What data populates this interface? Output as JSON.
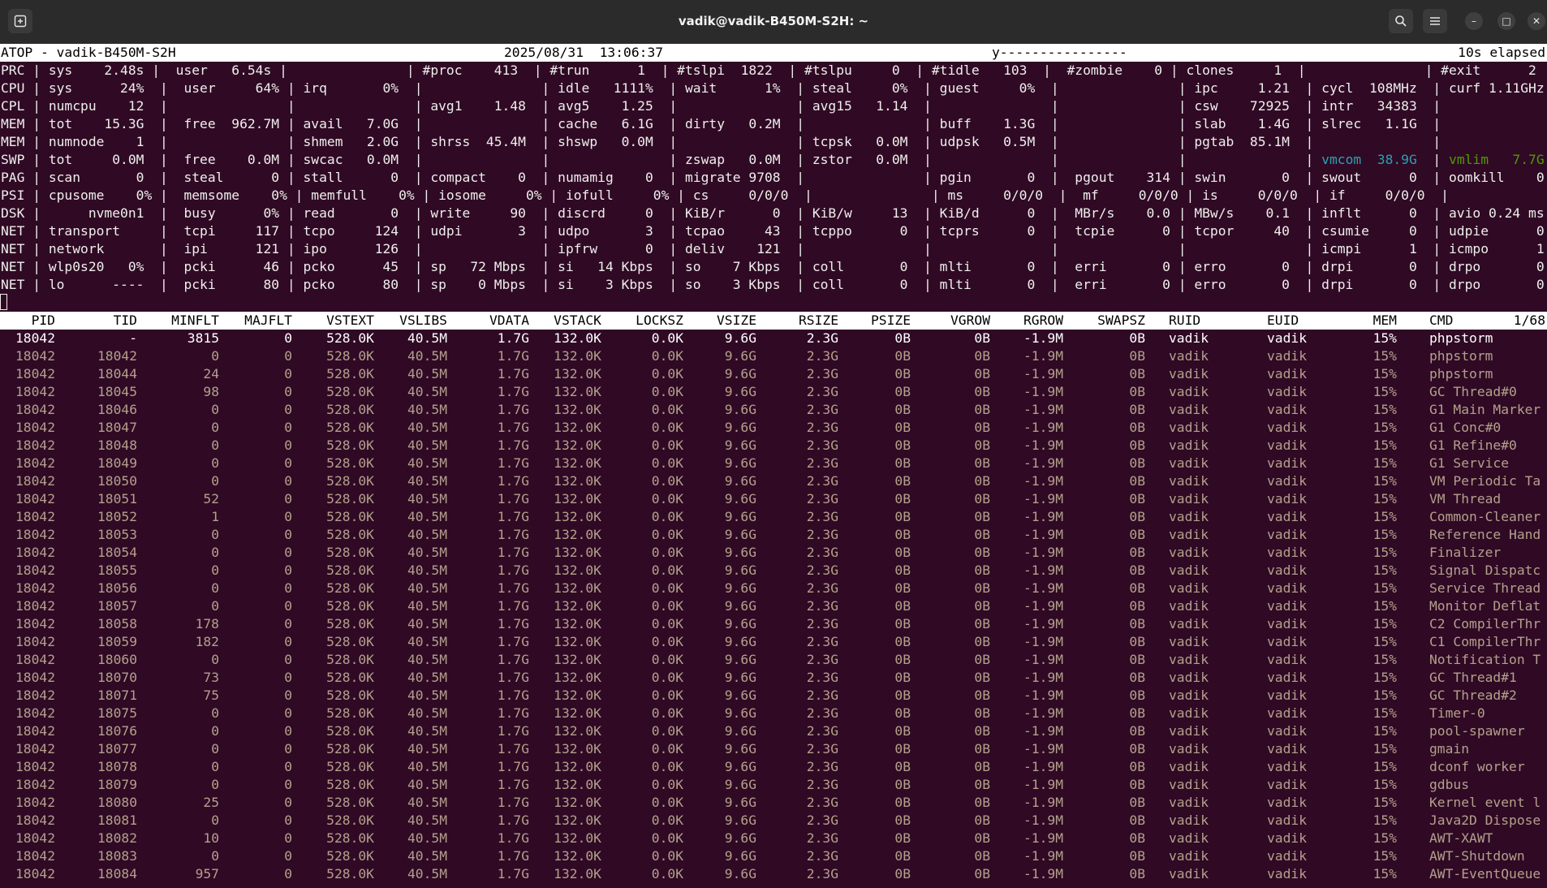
{
  "window": {
    "title": "vadik@vadik-B450M-S2H: ~"
  },
  "header": {
    "left": "ATOP - vadik-B450M-S2H",
    "datetime": "2025/08/31  13:06:37",
    "flags": "y----------------",
    "elapsed": "10s elapsed"
  },
  "colors": {
    "background": "#300a24",
    "text": "#eeeeec",
    "thread_text": "#b3a08c",
    "highlight": "#2aa1b3",
    "highlight2": "#4e9a06"
  },
  "sys_lines": [
    "PRC | sys    2.48s |  user   6.54s |               | #proc    413  | #trun      1  | #tslpi  1822  | #tslpu     0  | #tidle   103  |  #zombie    0 | clones     1  |               | #exit      2 |",
    "CPU | sys      24%  |  user     64% | irq       0%  |               | idle   1111%  | wait      1%  | steal     0%  | guest     0%  |               | ipc     1.21  | cycl  108MHz  | curf 1.11GHz |",
    "CPL | numcpu    12  |               |               | avg1    1.48  | avg5    1.25  |               | avg15   1.14  |               |               | csw    72925  | intr   34383  |              |",
    "MEM | tot    15.3G  |  free  962.7M | avail   7.0G  |               | cache   6.1G  | dirty   0.2M  |               | buff    1.3G  |               | slab    1.4G  | slrec   1.1G  |              |",
    "MEM | numnode    1  |               | shmem   2.0G  | shrss  45.4M  | shswp   0.0M  |               | tcpsk   0.0M  | udpsk   0.5M  |               | pgtab  85.1M  |               |              |",
    "SWP | tot     0.0M  |  free    0.0M | swcac   0.0M  |               |               | zswap   0.0M  | zstor   0.0M  |               |               |               | vmcom  38.9G  | vmlim   7.7G |",
    "PAG | scan       0  |  steal      0 | stall      0  | compact    0  | numamig    0  | migrate 9708  |               | pgin       0  |  pgout    314 | swin       0  | swout      0  | oomkill    0 |",
    "PSI | cpusome    0% |  memsome    0% | memfull    0% | iosome     0% | iofull     0% | cs     0/0/0  |               | ms     0/0/0  |  mf     0/0/0 | is     0/0/0  | if     0/0/0  |              |",
    "DSK |      nvme0n1  |  busy      0% | read       0  | write     90  | discrd     0  | KiB/r      0  | KiB/w     13  | KiB/d      0  |  MBr/s    0.0 | MBw/s    0.1  | inflt      0  | avio 0.24 ms |",
    "NET | transport     |  tcpi     117 | tcpo     124  | udpi       3  | udpo       3  | tcpao     43  | tcppo      0  | tcprs      0  |  tcpie      0 | tcpor     40  | csumie     0  | udpie      0 |",
    "NET | network       |  ipi      121 | ipo      126  |               | ipfrw      0  | deliv    121  |               |               |               |               | icmpi      1  | icmpo      1 |",
    "NET | wlp0s20   0%  |  pcki      46 | pcko      45  | sp   72 Mbps  | si   14 Kbps  | so    7 Kbps  | coll       0  | mlti       0  |  erri       0 | erro       0  | drpi       0  | drpo       0 |",
    "NET | lo      ----  |  pcki      80 | pcko      80  | sp    0 Mbps  | si    3 Kbps  | so    3 Kbps  | coll       0  | mlti       0  |  erri       0 | erro       0  | drpi       0  | drpo       0 |"
  ],
  "process_header": {
    "PID": "PID",
    "TID": "TID",
    "MINFLT": "MINFLT",
    "MAJFLT": "MAJFLT",
    "VSTEXT": "VSTEXT",
    "VSLIBS": "VSLIBS",
    "VDATA": "VDATA",
    "VSTACK": "VSTACK",
    "LOCKSZ": "LOCKSZ",
    "VSIZE": "VSIZE",
    "RSIZE": "RSIZE",
    "PSIZE": "PSIZE",
    "VGROW": "VGROW",
    "RGROW": "RGROW",
    "SWAPSZ": "SWAPSZ",
    "RUID": "RUID",
    "EUID": "EUID",
    "MEM": "MEM",
    "CMD": "CMD",
    "page": "1/68"
  },
  "processes": [
    {
      "pid": "18042",
      "tid": "-",
      "minflt": "3815",
      "cmd": "phpstorm"
    },
    {
      "pid": "18042",
      "tid": "18042",
      "minflt": "0",
      "cmd": "phpstorm"
    },
    {
      "pid": "18042",
      "tid": "18044",
      "minflt": "24",
      "cmd": "phpstorm"
    },
    {
      "pid": "18042",
      "tid": "18045",
      "minflt": "98",
      "cmd": "GC Thread#0"
    },
    {
      "pid": "18042",
      "tid": "18046",
      "minflt": "0",
      "cmd": "G1 Main Marker"
    },
    {
      "pid": "18042",
      "tid": "18047",
      "minflt": "0",
      "cmd": "G1 Conc#0"
    },
    {
      "pid": "18042",
      "tid": "18048",
      "minflt": "0",
      "cmd": "G1 Refine#0"
    },
    {
      "pid": "18042",
      "tid": "18049",
      "minflt": "0",
      "cmd": "G1 Service"
    },
    {
      "pid": "18042",
      "tid": "18050",
      "minflt": "0",
      "cmd": "VM Periodic Ta"
    },
    {
      "pid": "18042",
      "tid": "18051",
      "minflt": "52",
      "cmd": "VM Thread"
    },
    {
      "pid": "18042",
      "tid": "18052",
      "minflt": "1",
      "cmd": "Common-Cleaner"
    },
    {
      "pid": "18042",
      "tid": "18053",
      "minflt": "0",
      "cmd": "Reference Hand"
    },
    {
      "pid": "18042",
      "tid": "18054",
      "minflt": "0",
      "cmd": "Finalizer"
    },
    {
      "pid": "18042",
      "tid": "18055",
      "minflt": "0",
      "cmd": "Signal Dispatc"
    },
    {
      "pid": "18042",
      "tid": "18056",
      "minflt": "0",
      "cmd": "Service Thread"
    },
    {
      "pid": "18042",
      "tid": "18057",
      "minflt": "0",
      "cmd": "Monitor Deflat"
    },
    {
      "pid": "18042",
      "tid": "18058",
      "minflt": "178",
      "cmd": "C2 CompilerThr"
    },
    {
      "pid": "18042",
      "tid": "18059",
      "minflt": "182",
      "cmd": "C1 CompilerThr"
    },
    {
      "pid": "18042",
      "tid": "18060",
      "minflt": "0",
      "cmd": "Notification T"
    },
    {
      "pid": "18042",
      "tid": "18070",
      "minflt": "73",
      "cmd": "GC Thread#1"
    },
    {
      "pid": "18042",
      "tid": "18071",
      "minflt": "75",
      "cmd": "GC Thread#2"
    },
    {
      "pid": "18042",
      "tid": "18075",
      "minflt": "0",
      "cmd": "Timer-0"
    },
    {
      "pid": "18042",
      "tid": "18076",
      "minflt": "0",
      "cmd": "pool-spawner"
    },
    {
      "pid": "18042",
      "tid": "18077",
      "minflt": "0",
      "cmd": "gmain"
    },
    {
      "pid": "18042",
      "tid": "18078",
      "minflt": "0",
      "cmd": "dconf worker"
    },
    {
      "pid": "18042",
      "tid": "18079",
      "minflt": "0",
      "cmd": "gdbus"
    },
    {
      "pid": "18042",
      "tid": "18080",
      "minflt": "25",
      "cmd": "Kernel event l"
    },
    {
      "pid": "18042",
      "tid": "18081",
      "minflt": "0",
      "cmd": "Java2D Dispose"
    },
    {
      "pid": "18042",
      "tid": "18082",
      "minflt": "10",
      "cmd": "AWT-XAWT"
    },
    {
      "pid": "18042",
      "tid": "18083",
      "minflt": "0",
      "cmd": "AWT-Shutdown"
    },
    {
      "pid": "18042",
      "tid": "18084",
      "minflt": "957",
      "cmd": "AWT-EventQueue"
    }
  ],
  "common": {
    "majflt": "0",
    "vstext": "528.0K",
    "vslibs": "40.5M",
    "vdata": "1.7G",
    "vstack": "132.0K",
    "locksz": "0.0K",
    "vsize": "9.6G",
    "rsize": "2.3G",
    "psize": "0B",
    "vgrow": "0B",
    "rgrow": "-1.9M",
    "swapsz": "0B",
    "ruid": "vadik",
    "euid": "vadik",
    "mem": "15%"
  }
}
